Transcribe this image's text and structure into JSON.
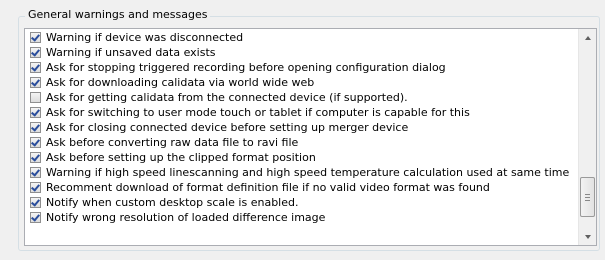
{
  "group": {
    "title": "General warnings and messages"
  },
  "options": [
    {
      "label": "Warning if device was disconnected",
      "checked": true
    },
    {
      "label": "Warning if unsaved data exists",
      "checked": true
    },
    {
      "label": "Ask for stopping triggered recording before opening configuration dialog",
      "checked": true
    },
    {
      "label": "Ask for downloading calidata via world wide web",
      "checked": true
    },
    {
      "label": "Ask for getting calidata from the connected device (if supported).",
      "checked": false
    },
    {
      "label": "Ask for switching to user mode touch or tablet if computer is capable for this",
      "checked": true
    },
    {
      "label": "Ask for closing connected device before setting up merger device",
      "checked": true
    },
    {
      "label": "Ask before converting raw data file to ravi file",
      "checked": true
    },
    {
      "label": "Ask before setting up the clipped format position",
      "checked": true
    },
    {
      "label": "Warning if high speed linescanning and high speed temperature calculation used at same time",
      "checked": true
    },
    {
      "label": "Recomment download of format definition file if no valid video format was found",
      "checked": true
    },
    {
      "label": "Notify when custom desktop scale is enabled.",
      "checked": true
    },
    {
      "label": "Notify wrong resolution of loaded difference image",
      "checked": true
    }
  ],
  "icons": {
    "scroll_up": "chevron-up-icon",
    "scroll_down": "chevron-down-icon",
    "checkmark": "checkmark-icon"
  },
  "colors": {
    "checkmark": "#2a4d9b",
    "list_background": "#ffffff",
    "window_background": "#f0f0f0"
  }
}
